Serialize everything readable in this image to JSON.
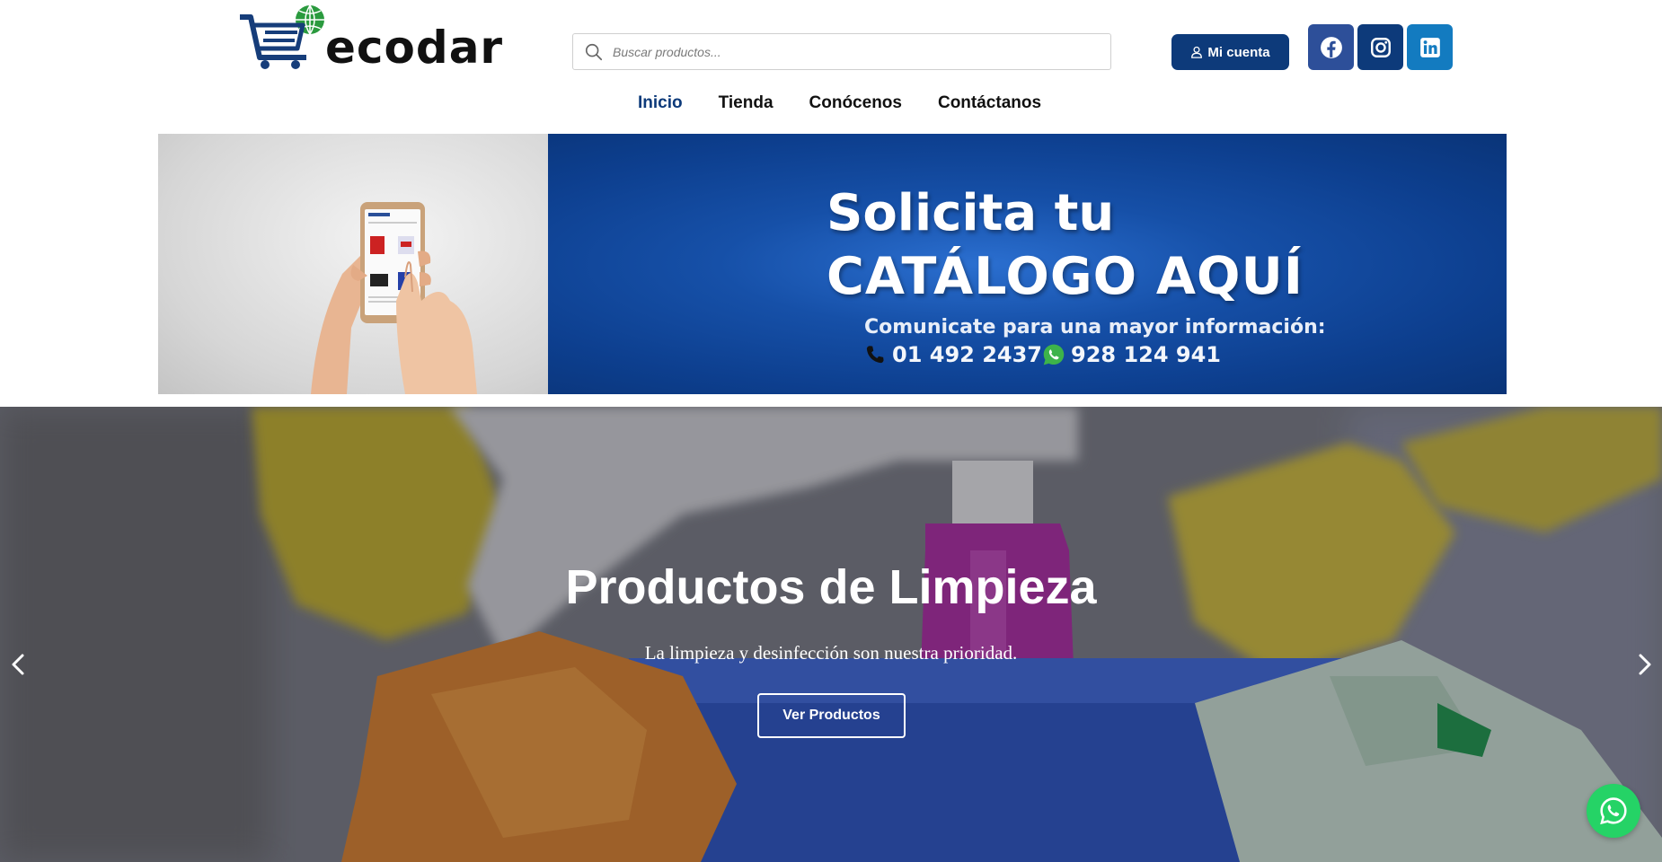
{
  "header": {
    "logo_text": "ecodar",
    "search": {
      "placeholder": "Buscar productos..."
    },
    "account_label": "Mi cuenta",
    "social": [
      "facebook-icon",
      "instagram-icon",
      "linkedin-icon"
    ]
  },
  "nav": {
    "items": [
      {
        "label": "Inicio",
        "active": true
      },
      {
        "label": "Tienda",
        "active": false
      },
      {
        "label": "Conócenos",
        "active": false
      },
      {
        "label": "Contáctanos",
        "active": false
      }
    ]
  },
  "banner": {
    "title_line1": "Solicita tu",
    "title_line2": "CATÁLOGO AQUÍ",
    "subtitle": "Comunicate  para una mayor información:",
    "phone": "01 492 2437",
    "whatsapp": "928 124 941"
  },
  "hero": {
    "title": "Productos de Limpieza",
    "subtitle": "La limpieza y desinfección son nuestra prioridad.",
    "button_label": "Ver Productos"
  },
  "colors": {
    "brand_blue": "#0d3a7a",
    "facebook": "#2d4f99",
    "linkedin": "#137bc0",
    "whatsapp": "#25d366"
  }
}
